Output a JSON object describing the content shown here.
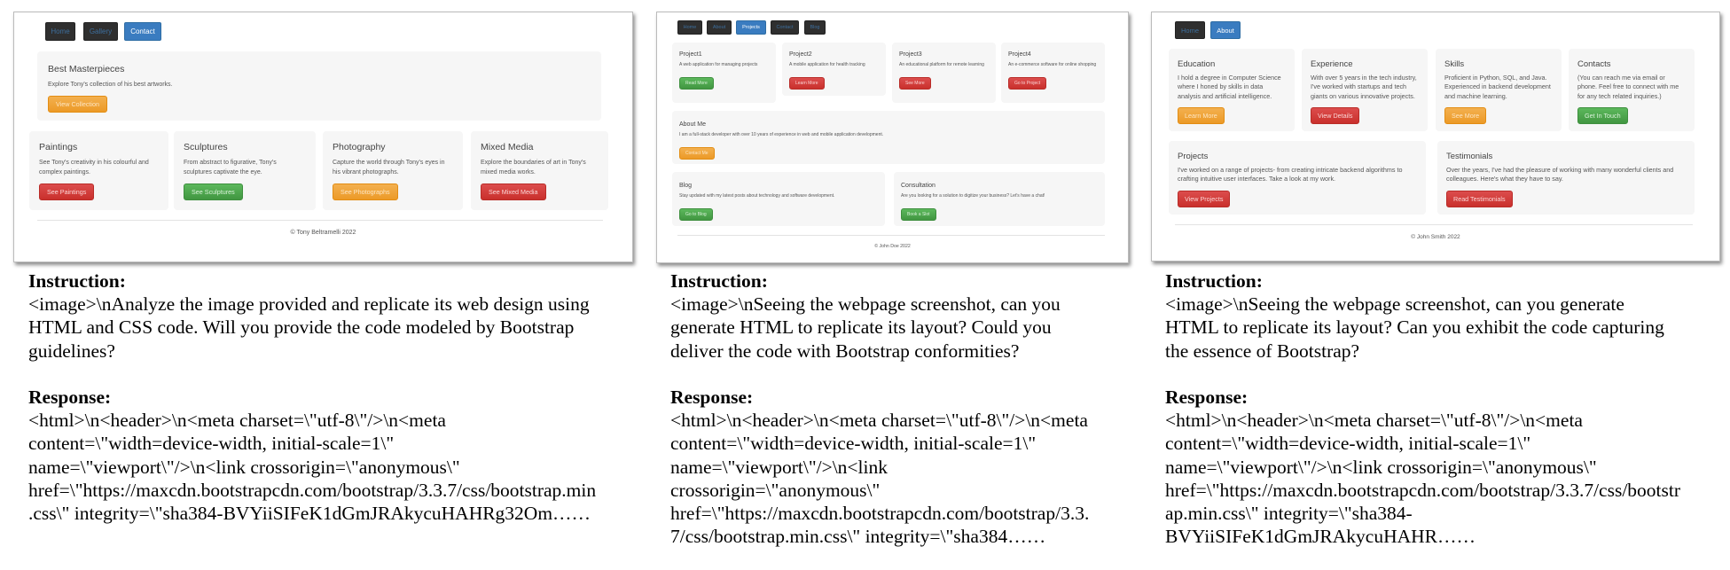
{
  "shots": [
    {
      "nav": [
        "Home",
        "Gallery",
        "Contact"
      ],
      "jumbotron": {
        "title": "Best Masterpieces",
        "text": "Explore Tony's collection of his best artworks.",
        "button": "View Collection"
      },
      "cards": [
        {
          "title": "Paintings",
          "text": "See Tony's creativity in his colourful and complex paintings.",
          "button": "See Paintings"
        },
        {
          "title": "Sculptures",
          "text": "From abstract to figurative, Tony's sculptures captivate the eye.",
          "button": "See Sculptures"
        },
        {
          "title": "Photography",
          "text": "Capture the world through Tony's eyes in his vibrant photographs.",
          "button": "See Photographs"
        },
        {
          "title": "Mixed Media",
          "text": "Explore the boundaries of art in Tony's mixed media works.",
          "button": "See Mixed Media"
        }
      ],
      "footer": "© Tony Beltramelli 2022"
    },
    {
      "nav": [
        "Home",
        "About",
        "Projects",
        "Contact",
        "Blog"
      ],
      "projects": [
        {
          "title": "Project1",
          "text": "A web application for managing projects",
          "button": "Read More"
        },
        {
          "title": "Project2",
          "text": "A mobile application for health tracking",
          "button": "Learn More"
        },
        {
          "title": "Project3",
          "text": "An educational platform for remote learning",
          "button": "See More"
        },
        {
          "title": "Project4",
          "text": "An e-commerce software for online shopping",
          "button": "Go to Project"
        }
      ],
      "about": {
        "title": "About Me",
        "text": "I am a full-stack developer with over 10 years of experience in web and mobile application development.",
        "button": "Contact Me"
      },
      "blog": {
        "title": "Blog",
        "text": "Stay updated with my latest posts about technology and software development.",
        "button": "Go to Blog"
      },
      "consultation": {
        "title": "Consultation",
        "text": "Are you looking for a solution to digitize your business? Let's have a chat!",
        "button": "Book a Slot"
      },
      "footer": "© John Doe 2022"
    },
    {
      "nav": [
        "Home",
        "About"
      ],
      "row1": [
        {
          "title": "Education",
          "text": "I hold a degree in Computer Science where I honed by skills in data analysis and artificial intelligence.",
          "button": "Learn More"
        },
        {
          "title": "Experience",
          "text": "With over 5 years in the tech industry, I've worked with startups and tech giants on various innovative projects.",
          "button": "View Details"
        },
        {
          "title": "Skills",
          "text": "Proficient in Python, SQL, and Java. Experienced in backend development and machine learning.",
          "button": "See More"
        },
        {
          "title": "Contacts",
          "text": "(You can reach me via email or phone. Feel free to connect with me for any tech related inquiries.)",
          "button": "Get In Touch"
        }
      ],
      "row2": [
        {
          "title": "Projects",
          "text": "I've worked on a range of projects- from creating intricate backend algorithms to crafting intuitive user interfaces. Take a look at my work.",
          "button": "View Projects"
        },
        {
          "title": "Testimonials",
          "text": "Over the years, I've had the pleasure of working with many wonderful clients and colleagues. Here's what they have to say.",
          "button": "Read Testimonials"
        }
      ],
      "footer": "© John Smith 2022"
    }
  ],
  "captions": [
    {
      "instruction_label": "Instruction:",
      "instruction_lines": [
        "<image>\\nAnalyze the image provided and replicate its web design using",
        "HTML and CSS code. Will you provide the code modeled by Bootstrap",
        "guidelines?"
      ],
      "response_label": "Response:",
      "response_lines": [
        "<html>\\n<header>\\n<meta charset=\\\"utf-8\\\"/>\\n<meta",
        "content=\\\"width=device-width, initial-scale=1\\\"",
        "name=\\\"viewport\\\"/>\\n<link crossorigin=\\\"anonymous\\\"",
        "href=\\\"https://maxcdn.bootstrapcdn.com/bootstrap/3.3.7/css/bootstrap.min",
        ".css\\\" integrity=\\\"sha384-BVYiiSIFeK1dGmJRAkycuHAHRg32Om……"
      ]
    },
    {
      "instruction_label": "Instruction:",
      "instruction_lines": [
        "<image>\\nSeeing the webpage screenshot, can you",
        "generate HTML to replicate its layout? Could you",
        "deliver the code with Bootstrap conformities?"
      ],
      "response_label": "Response:",
      "response_lines": [
        "<html>\\n<header>\\n<meta charset=\\\"utf-8\\\"/>\\n<meta",
        "content=\\\"width=device-width, initial-scale=1\\\"",
        "name=\\\"viewport\\\"/>\\n<link",
        "crossorigin=\\\"anonymous\\\"",
        "href=\\\"https://maxcdn.bootstrapcdn.com/bootstrap/3.3.",
        "7/css/bootstrap.min.css\\\" integrity=\\\"sha384……"
      ]
    },
    {
      "instruction_label": "Instruction:",
      "instruction_lines": [
        "<image>\\nSeeing the webpage screenshot, can you generate",
        "HTML to replicate its layout? Can you exhibit the code capturing",
        "the essence of Bootstrap?"
      ],
      "response_label": "Response:",
      "response_lines": [
        "<html>\\n<header>\\n<meta charset=\\\"utf-8\\\"/>\\n<meta",
        "content=\\\"width=device-width, initial-scale=1\\\"",
        "name=\\\"viewport\\\"/>\\n<link crossorigin=\\\"anonymous\\\"",
        "href=\\\"https://maxcdn.bootstrapcdn.com/bootstrap/3.3.7/css/bootstr",
        "ap.min.css\\\" integrity=\\\"sha384-",
        "BVYiiSIFeK1dGmJRAkycuHAHR……"
      ]
    }
  ]
}
